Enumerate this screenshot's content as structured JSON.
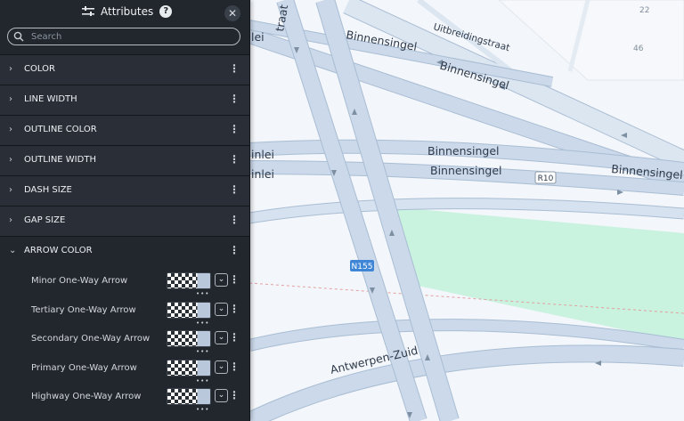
{
  "panel": {
    "title": "Attributes",
    "search_placeholder": "Search",
    "sections": [
      {
        "label": "COLOR",
        "expanded": false
      },
      {
        "label": "LINE WIDTH",
        "expanded": false
      },
      {
        "label": "OUTLINE COLOR",
        "expanded": false
      },
      {
        "label": "OUTLINE WIDTH",
        "expanded": false
      },
      {
        "label": "DASH SIZE",
        "expanded": false
      },
      {
        "label": "GAP SIZE",
        "expanded": false
      },
      {
        "label": "ARROW COLOR",
        "expanded": true
      }
    ],
    "arrow_color_items": [
      {
        "label": "Minor One-Way Arrow"
      },
      {
        "label": "Tertiary One-Way Arrow"
      },
      {
        "label": "Secondary One-Way Arrow"
      },
      {
        "label": "Primary One-Way Arrow"
      },
      {
        "label": "Highway One-Way Arrow"
      }
    ],
    "icons": {
      "filter": "sliders-icon",
      "help": "?",
      "close": "✕",
      "expand_collapsed": "›",
      "expand_open": "⌄",
      "menu": "⋮",
      "dropdown": "⌄",
      "swatch_menu": "•••"
    }
  },
  "map": {
    "labels": {
      "straat_fragment": "traat",
      "uitbreidingstraat": "Uitbreidingstraat",
      "binnensingel": "Binnensingel",
      "lei_fragment_1": "lei",
      "lei_fragment_2": "inlei",
      "lei_fragment_3": "inlei",
      "antwerpen_zuid": "Antwerpen-Zuid",
      "r10": "R10",
      "n155": "N155",
      "num_22": "22",
      "num_46": "46"
    },
    "colors": {
      "background": "#f3f6fa",
      "road_fill": "#cbd9ea",
      "road_edge": "#a9bdd4",
      "park": "#c9f2df",
      "block": "#eef3f8",
      "shield_blue": "#3f86d6"
    }
  }
}
